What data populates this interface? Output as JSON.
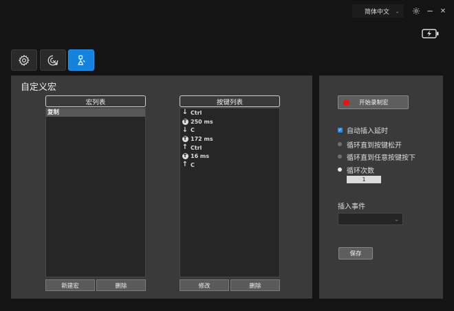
{
  "header": {
    "language": "简体中文",
    "language_chevron": "⌄",
    "minimize_glyph": "−",
    "close_glyph": "✕"
  },
  "tabs": [
    {
      "icon": "gear-icon",
      "active": false
    },
    {
      "icon": "target-cursor-icon",
      "active": false
    },
    {
      "icon": "macro-joystick-icon",
      "active": true
    }
  ],
  "page": {
    "title": "自定义宏"
  },
  "macro_list": {
    "header": "宏列表",
    "items": [
      "复制"
    ],
    "new_button": "新建宏",
    "delete_button": "删除"
  },
  "key_list": {
    "header": "按键列表",
    "items": [
      {
        "type": "down",
        "text": "Ctrl"
      },
      {
        "type": "delay",
        "text": "250 ms"
      },
      {
        "type": "down",
        "text": "C"
      },
      {
        "type": "delay",
        "text": "172 ms"
      },
      {
        "type": "up",
        "text": "Ctrl"
      },
      {
        "type": "delay",
        "text": "16 ms"
      },
      {
        "type": "up",
        "text": "C"
      }
    ],
    "delay_glyph": "T",
    "edit_button": "修改",
    "delete_button": "删除"
  },
  "options": {
    "record_button": "开始录制宏",
    "auto_delay": "自动插入延时",
    "check_glyph": "✓",
    "loop_release": "循环直到按键松开",
    "loop_any_key": "循环直到任意按键按下",
    "loop_count_label": "循环次数",
    "loop_count_value": "1",
    "insert_event_label": "插入事件",
    "select_chevron": "⌄",
    "save_button": "保存"
  },
  "colors": {
    "accent": "#1483e0",
    "record_dot": "#e11111",
    "panel": "#3a3a3a",
    "background": "#141414"
  }
}
